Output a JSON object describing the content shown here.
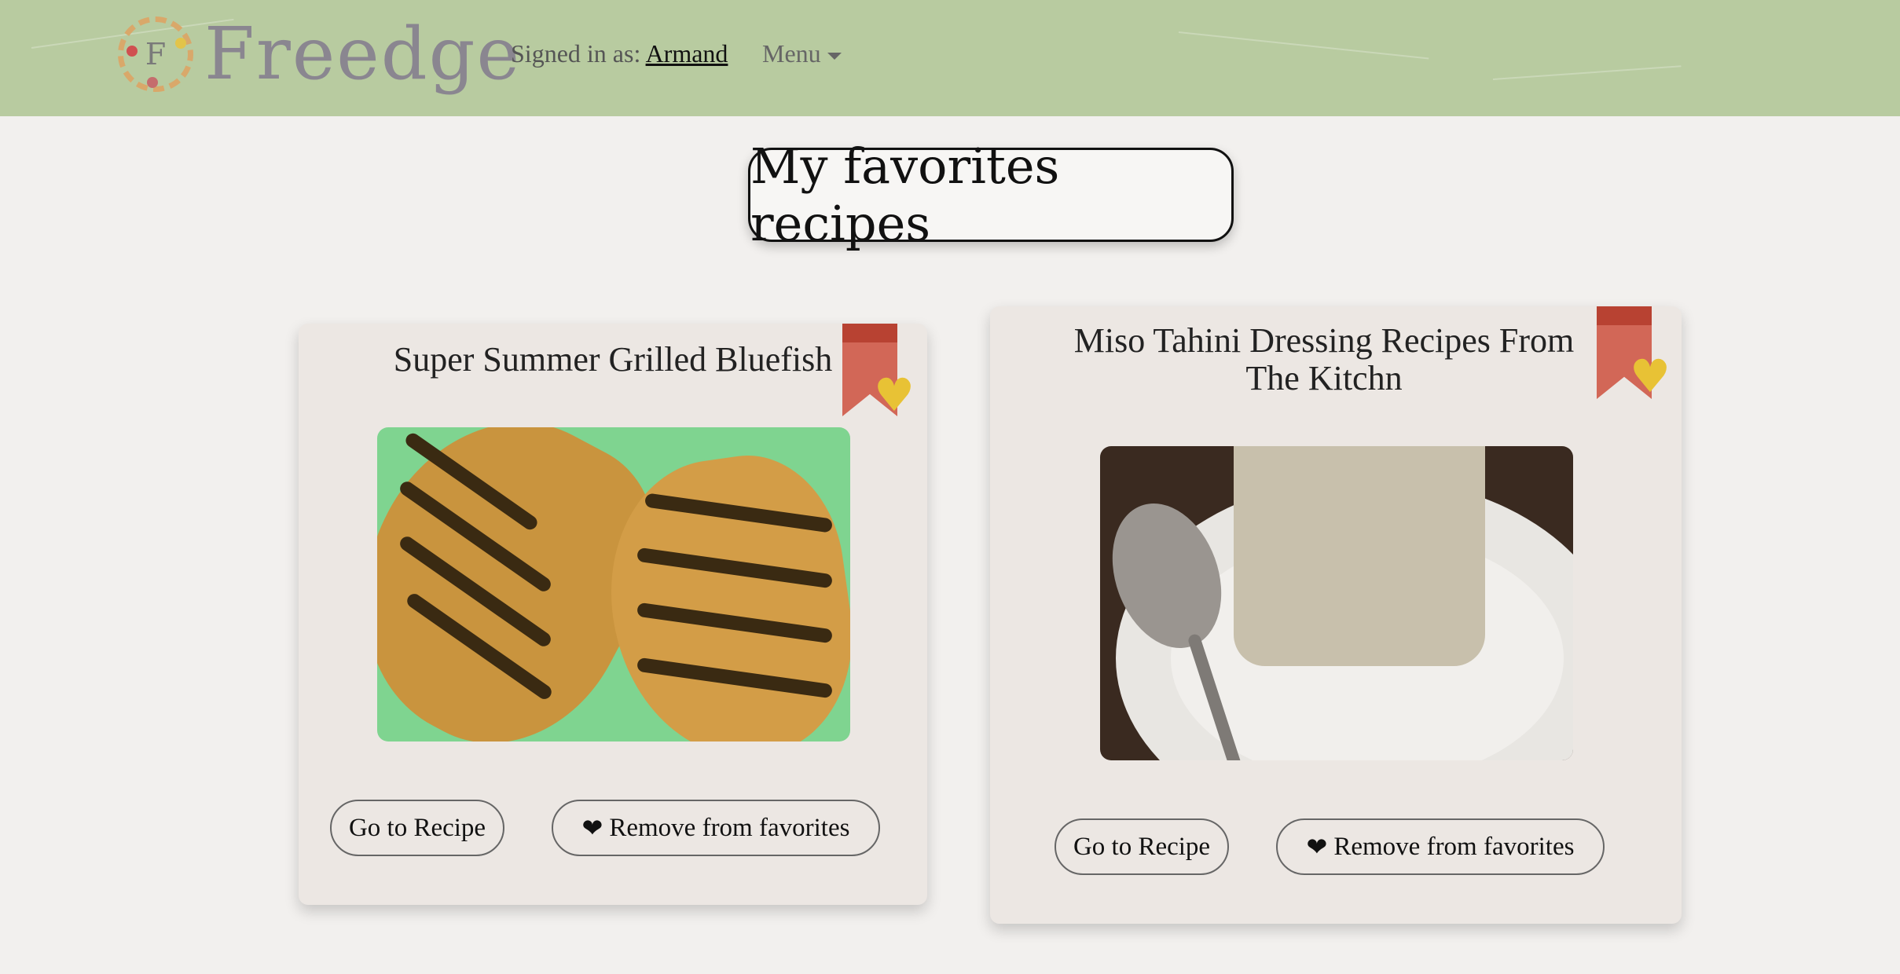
{
  "header": {
    "logo_letter": "F",
    "brand": "Freedge",
    "signed_in_prefix": "Signed in as:",
    "username": "Armand",
    "menu_label": "Menu"
  },
  "page": {
    "title": "My favorites recipes"
  },
  "recipes": [
    {
      "title": "Super Summer Grilled Bluefish",
      "go_label": "Go to Recipe",
      "remove_label": "Remove from favorites",
      "remove_icon": "broken-heart-icon"
    },
    {
      "title": "Miso Tahini Dressing Recipes From The Kitchn",
      "go_label": "Go to Recipe",
      "remove_label": "Remove from favorites",
      "remove_icon": "broken-heart-icon"
    }
  ],
  "colors": {
    "navbar": "#b8cba0",
    "background": "#f2f0ee",
    "card": "#ece7e3",
    "bookmark": "#d26757",
    "heart": "#e8c235"
  }
}
